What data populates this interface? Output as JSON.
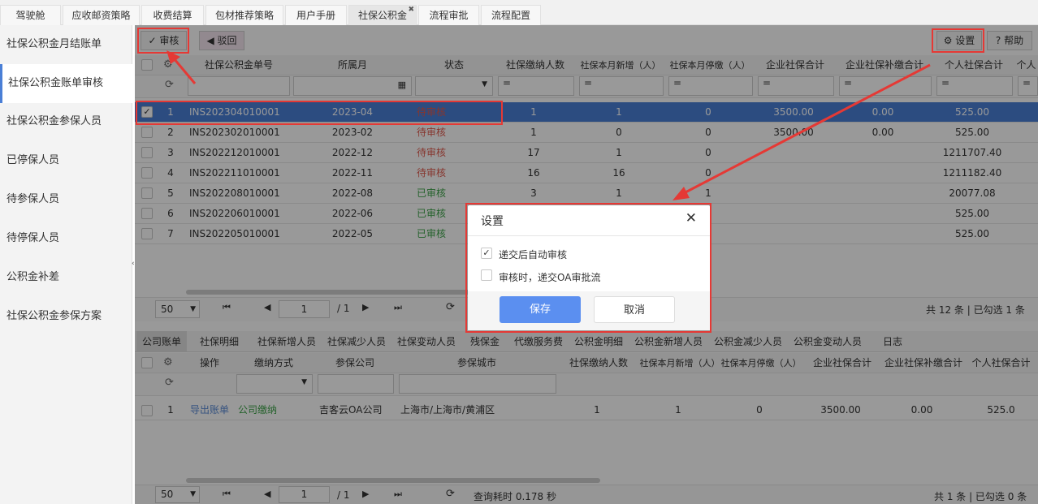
{
  "top_tabs": [
    {
      "label": "驾驶舱"
    },
    {
      "label": "应收邮资策略"
    },
    {
      "label": "收费结算"
    },
    {
      "label": "包材推荐策略"
    },
    {
      "label": "用户手册"
    },
    {
      "label": "社保公积金",
      "active": true,
      "close": "✖"
    },
    {
      "label": "流程审批"
    },
    {
      "label": "流程配置"
    }
  ],
  "sidebar": {
    "items": [
      {
        "label": "社保公积金月结账单"
      },
      {
        "label": "社保公积金账单审核",
        "active": true
      },
      {
        "label": "社保公积金参保人员"
      },
      {
        "label": "已停保人员"
      },
      {
        "label": "待参保人员"
      },
      {
        "label": "待停保人员"
      },
      {
        "label": "公积金补差"
      },
      {
        "label": "社保公积金参保方案"
      }
    ]
  },
  "toolbar": {
    "audit": "审核",
    "reject": "驳回",
    "settings": "设置",
    "help": "帮助"
  },
  "grid": {
    "columns": [
      "社保公积金单号",
      "所属月",
      "状态",
      "社保缴纳人数",
      "社保本月新增（人）",
      "社保本月停缴（人）",
      "企业社保合计",
      "企业社保补缴合计",
      "个人社保合计",
      "个人"
    ],
    "filter_eq": "=",
    "rows": [
      {
        "n": "1",
        "id": "INS202304010001",
        "month": "2023-04",
        "status": "待审核",
        "s": "pending",
        "a": "1",
        "b": "1",
        "c": "0",
        "d": "3500.00",
        "e": "0.00",
        "f": "525.00",
        "selected": true
      },
      {
        "n": "2",
        "id": "INS202302010001",
        "month": "2023-02",
        "status": "待审核",
        "s": "pending",
        "a": "1",
        "b": "0",
        "c": "0",
        "d": "3500.00",
        "e": "0.00",
        "f": "525.00"
      },
      {
        "n": "3",
        "id": "INS202212010001",
        "month": "2022-12",
        "status": "待审核",
        "s": "pending",
        "a": "17",
        "b": "1",
        "c": "0",
        "d": "",
        "e": "",
        "f": "1211707.40"
      },
      {
        "n": "4",
        "id": "INS202211010001",
        "month": "2022-11",
        "status": "待审核",
        "s": "pending",
        "a": "16",
        "b": "16",
        "c": "0",
        "d": "",
        "e": "",
        "f": "1211182.40"
      },
      {
        "n": "5",
        "id": "INS202208010001",
        "month": "2022-08",
        "status": "已审核",
        "s": "done",
        "a": "3",
        "b": "1",
        "c": "1",
        "d": "",
        "e": "",
        "f": "20077.08"
      },
      {
        "n": "6",
        "id": "INS202206010001",
        "month": "2022-06",
        "status": "已审核",
        "s": "done",
        "a": "",
        "b": "",
        "c": "0",
        "d": "",
        "e": "",
        "f": "525.00"
      },
      {
        "n": "7",
        "id": "INS202205010001",
        "month": "2022-05",
        "status": "已审核",
        "s": "done",
        "a": "",
        "b": "",
        "c": "0",
        "d": "",
        "e": "",
        "f": "525.00"
      }
    ],
    "pager": {
      "size": "50",
      "page": "1",
      "total_pages": "/ 1",
      "summary": "共 12 条 | 已勾选 1 条"
    }
  },
  "bottom_tabs": [
    "公司账单",
    "社保明细",
    "社保新增人员",
    "社保减少人员",
    "社保变动人员",
    "残保金",
    "代缴服务费",
    "公积金明细",
    "公积金新增人员",
    "公积金减少人员",
    "公积金变动人员",
    "日志"
  ],
  "bottom_grid": {
    "columns": [
      "操作",
      "缴纳方式",
      "参保公司",
      "参保城市",
      "社保缴纳人数",
      "社保本月新增（人）",
      "社保本月停缴（人）",
      "企业社保合计",
      "企业社保补缴合计",
      "个人社保合计"
    ],
    "row": {
      "n": "1",
      "op": "导出账单",
      "mode": "公司缴纳",
      "company": "吉客云OA公司",
      "city": "上海市/上海市/黄浦区",
      "a": "1",
      "b": "1",
      "c": "0",
      "d": "3500.00",
      "e": "0.00",
      "f": "525.0"
    },
    "pager": {
      "size": "50",
      "page": "1",
      "total_pages": "/ 1",
      "query_time": "查询耗时 0.178 秒",
      "summary": "共 1 条 | 已勾选 0 条"
    }
  },
  "dialog": {
    "title": "设置",
    "opt1": "递交后自动审核",
    "opt1_checked": true,
    "opt2": "审核时，递交OA审批流",
    "opt2_checked": false,
    "save": "保存",
    "cancel": "取消"
  },
  "colors": {
    "accent": "#5b8ff0",
    "pending": "#e05a4e",
    "done": "#3ea44a",
    "annotation": "#e53935"
  }
}
